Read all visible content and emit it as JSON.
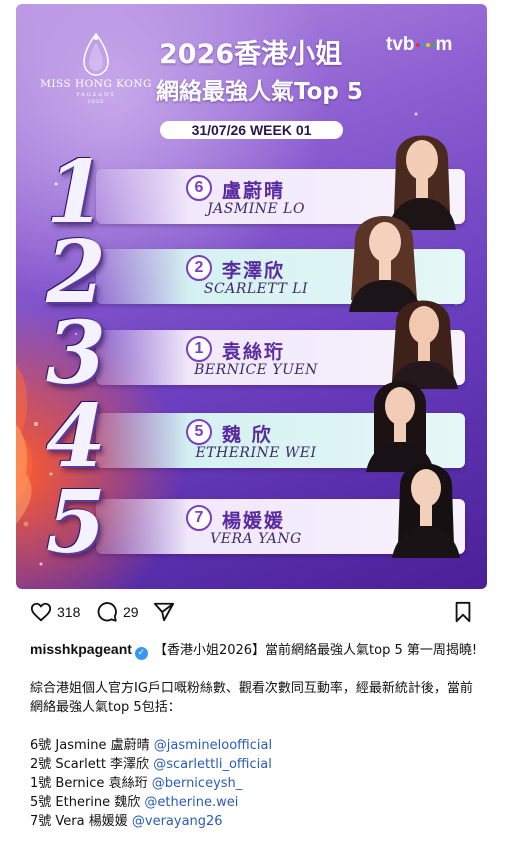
{
  "graphic": {
    "logo": {
      "line1": "MISS HONG KONG",
      "line2": "PAGEANT",
      "line3": "2026"
    },
    "title_line1": "2026香港小姐",
    "title_line2": "網絡最強人氣Top 5",
    "broadcaster": {
      "prefix": "tvb",
      "suffix": "m",
      "dot_colors": [
        "#e4322b",
        "#27a3dd",
        "#f6c11a",
        "#38b54a"
      ]
    },
    "week_label": "31/07/26 WEEK 01",
    "rankings": [
      {
        "rank": "1",
        "number": "6",
        "name_cn": "盧蔚晴",
        "name_en": "JASMINE LO"
      },
      {
        "rank": "2",
        "number": "2",
        "name_cn": "李澤欣",
        "name_en": "SCARLETT LI"
      },
      {
        "rank": "3",
        "number": "1",
        "name_cn": "袁絲珩",
        "name_en": "BERNICE YUEN"
      },
      {
        "rank": "4",
        "number": "5",
        "name_cn": "魏 欣",
        "name_en": "ETHERINE WEI"
      },
      {
        "rank": "5",
        "number": "7",
        "name_cn": "楊媛媛",
        "name_en": "VERA YANG"
      }
    ]
  },
  "actions": {
    "likes": "318",
    "comments": "29"
  },
  "caption": {
    "handle": "misshkpageant",
    "headline": "【香港小姐2026】當前網絡最強人氣top 5 第一周揭曉!",
    "body": "綜合港姐個人官方IG戶口嘅粉絲數、觀看次數同互動率，經最新統計後，當前網絡最強人氣top 5包括：",
    "entries": [
      {
        "text": "6號 Jasmine 盧蔚晴 ",
        "mention": "@jasmineloofficial"
      },
      {
        "text": "2號 Scarlett 李澤欣 ",
        "mention": "@scarlettli_official"
      },
      {
        "text": "1號 Bernice 袁絲珩 ",
        "mention": "@berniceysh_"
      },
      {
        "text": "5號 Etherine 魏欣 ",
        "mention": "@etherine.wei"
      },
      {
        "text": "7號 Vera 楊媛媛 ",
        "mention": "@verayang26"
      }
    ]
  }
}
